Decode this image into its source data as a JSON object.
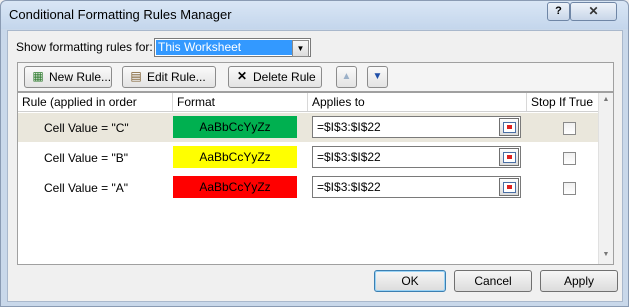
{
  "window": {
    "title": "Conditional Formatting Rules Manager",
    "help_glyph": "?",
    "close_glyph": "✕"
  },
  "filter": {
    "label": "Show formatting rules for:",
    "selected": "This Worksheet"
  },
  "toolbar": {
    "new_rule": "New Rule...",
    "edit_rule": "Edit Rule...",
    "delete_rule": "Delete Rule"
  },
  "columns": {
    "rule": "Rule (applied in order shown)",
    "format": "Format",
    "applies_to": "Applies to",
    "stop_if_true": "Stop If True"
  },
  "rules": [
    {
      "name": "Cell Value = \"C\"",
      "preview": "AaBbCcYyZz",
      "fill": "#00b050",
      "text_color": "#000000",
      "applies_to": "=$I$3:$I$22",
      "stop_if_true": false,
      "selected": true
    },
    {
      "name": "Cell Value = \"B\"",
      "preview": "AaBbCcYyZz",
      "fill": "#ffff00",
      "text_color": "#000000",
      "applies_to": "=$I$3:$I$22",
      "stop_if_true": false,
      "selected": false
    },
    {
      "name": "Cell Value = \"A\"",
      "preview": "AaBbCcYyZz",
      "fill": "#ff0000",
      "text_color": "#000000",
      "applies_to": "=$I$3:$I$22",
      "stop_if_true": false,
      "selected": false
    }
  ],
  "buttons": {
    "ok": "OK",
    "cancel": "Cancel",
    "apply": "Apply"
  }
}
